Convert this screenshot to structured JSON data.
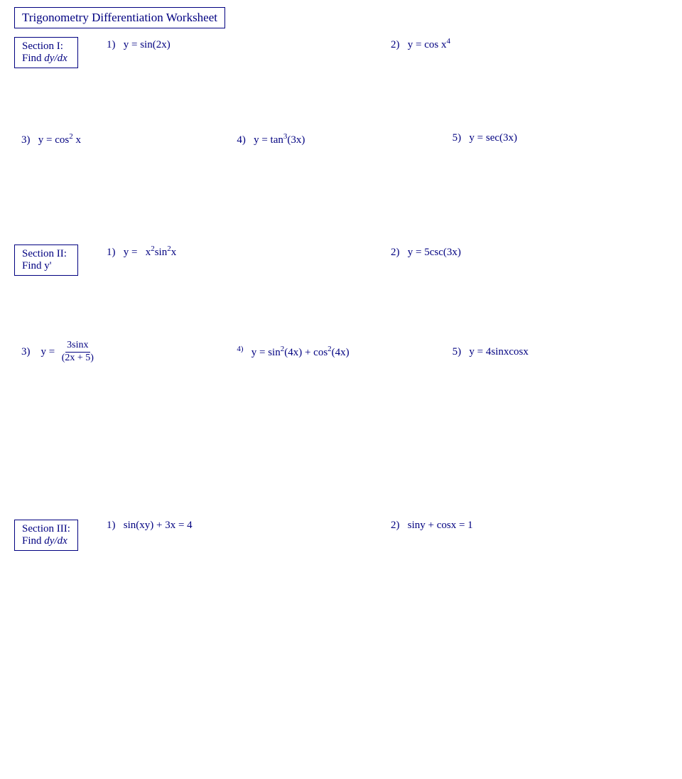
{
  "title": "Trigonometry Differentiation Worksheet",
  "section1": {
    "label1": "Section I:",
    "label2": "Find dy/dx",
    "problems": [
      {
        "num": "1)",
        "expr": "y = sin(2x)"
      },
      {
        "num": "2)",
        "expr": "y = cos x⁴"
      }
    ],
    "problems2": [
      {
        "num": "3)",
        "expr": "y = cos²x"
      },
      {
        "num": "4)",
        "expr": "y = tan³(3x)"
      },
      {
        "num": "5)",
        "expr": "y = sec(3x)"
      }
    ]
  },
  "section2": {
    "label1": "Section II:",
    "label2": "Find y'",
    "problems": [
      {
        "num": "1)",
        "expr": "y = x²sin²x"
      },
      {
        "num": "2)",
        "expr": "y = 5csc(3x)"
      }
    ],
    "problems2_num": "3)",
    "problems2_expr_num": "3sinx",
    "problems2_expr_den": "(2x + 5)",
    "problems3": [
      {
        "num": "4)",
        "expr": "y = sin²(4x) + cos²(4x)"
      },
      {
        "num": "5)",
        "expr": "y = 4sinxcosx"
      }
    ]
  },
  "section3": {
    "label1": "Section III:",
    "label2": "Find dy/dx",
    "problems": [
      {
        "num": "1)",
        "expr": "sin(xy) + 3x = 4"
      },
      {
        "num": "2)",
        "expr": "siny + cosx = 1"
      }
    ]
  }
}
